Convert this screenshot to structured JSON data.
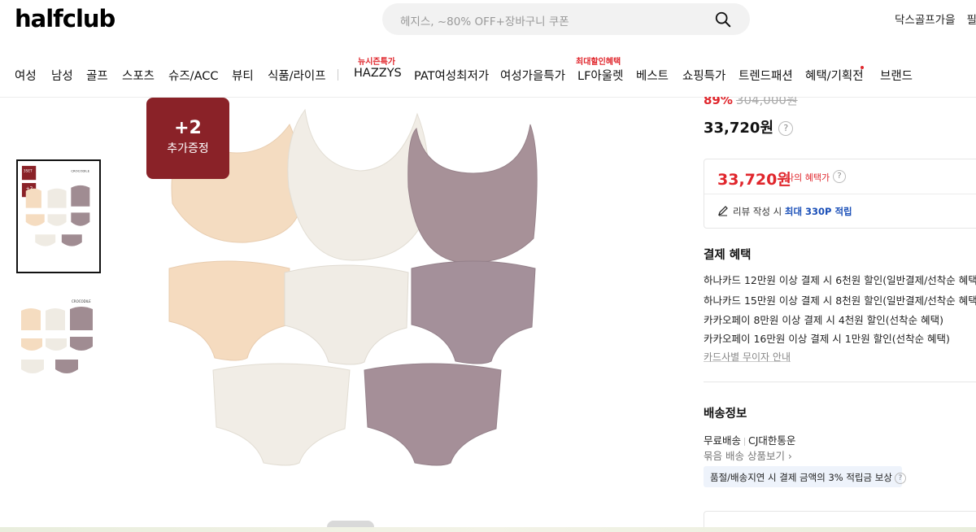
{
  "header": {
    "logo": "halfclub",
    "search_placeholder": "헤지스, ~80% OFF+장바구니 쿠폰",
    "top_links": [
      "닥스골프가을",
      "필"
    ]
  },
  "nav": {
    "items": [
      "여성",
      "남성",
      "골프",
      "스포츠",
      "슈즈/ACC",
      "뷰티",
      "식품/라이프",
      "HAZZYS",
      "PAT여성최저가",
      "여성가을특가",
      "LF아울렛",
      "베스트",
      "쇼핑특가",
      "트렌드패션",
      "혜택/기획전",
      "브랜드"
    ],
    "tags": {
      "hazzys": "뉴시즌특가",
      "lf": "최대할인혜택"
    }
  },
  "product": {
    "badge_big": "+2",
    "badge_small": "추가증정",
    "thumb_brand": "CROCODILE",
    "thumb_set": "3SET",
    "discount_rate": "89%",
    "original_price": "304,000원",
    "price": "33,720원",
    "benefit_price": "33,720원",
    "benefit_label": "나의 혜택가",
    "review_text": "리뷰 작성 시",
    "review_highlight": "최대 330P 적립"
  },
  "payment": {
    "title": "결제 혜택",
    "lines": [
      "하나카드 12만원 이상 결제 시 6천원 할인(일반결제/선착순 혜택)",
      "하나카드 15만원 이상 결제 시 8천원 할인(일반결제/선착순 혜택)",
      "카카오페이 8만원 이상 결제 시 4천원 할인(선착순 혜택)",
      "카카오페이 16만원 이상 결제 시 1만원 할인(선착순 혜택)"
    ],
    "link": "카드사별 무이자 안내"
  },
  "shipping": {
    "title": "배송정보",
    "free": "무료배송",
    "carrier": "CJ대한통운",
    "bundle_link": "묶음 배송 상품보기 ›",
    "note": "품절/배송지연 시 결제 금액의 3% 적립금 보상"
  },
  "colors": {
    "brand_red": "#e0262c",
    "badge": "#8a2228",
    "beige": "#f5dcc0",
    "ivory": "#efebe3",
    "mauve": "#a08c92"
  }
}
